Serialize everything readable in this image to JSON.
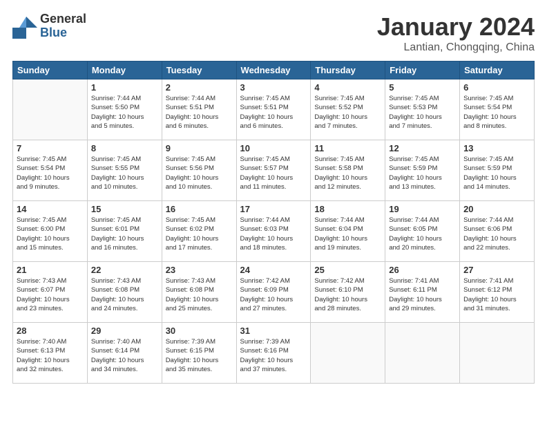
{
  "logo": {
    "general": "General",
    "blue": "Blue"
  },
  "title": {
    "month": "January 2024",
    "location": "Lantian, Chongqing, China"
  },
  "headers": [
    "Sunday",
    "Monday",
    "Tuesday",
    "Wednesday",
    "Thursday",
    "Friday",
    "Saturday"
  ],
  "weeks": [
    [
      {
        "day": "",
        "info": ""
      },
      {
        "day": "1",
        "info": "Sunrise: 7:44 AM\nSunset: 5:50 PM\nDaylight: 10 hours\nand 5 minutes."
      },
      {
        "day": "2",
        "info": "Sunrise: 7:44 AM\nSunset: 5:51 PM\nDaylight: 10 hours\nand 6 minutes."
      },
      {
        "day": "3",
        "info": "Sunrise: 7:45 AM\nSunset: 5:51 PM\nDaylight: 10 hours\nand 6 minutes."
      },
      {
        "day": "4",
        "info": "Sunrise: 7:45 AM\nSunset: 5:52 PM\nDaylight: 10 hours\nand 7 minutes."
      },
      {
        "day": "5",
        "info": "Sunrise: 7:45 AM\nSunset: 5:53 PM\nDaylight: 10 hours\nand 7 minutes."
      },
      {
        "day": "6",
        "info": "Sunrise: 7:45 AM\nSunset: 5:54 PM\nDaylight: 10 hours\nand 8 minutes."
      }
    ],
    [
      {
        "day": "7",
        "info": "Sunrise: 7:45 AM\nSunset: 5:54 PM\nDaylight: 10 hours\nand 9 minutes."
      },
      {
        "day": "8",
        "info": "Sunrise: 7:45 AM\nSunset: 5:55 PM\nDaylight: 10 hours\nand 10 minutes."
      },
      {
        "day": "9",
        "info": "Sunrise: 7:45 AM\nSunset: 5:56 PM\nDaylight: 10 hours\nand 10 minutes."
      },
      {
        "day": "10",
        "info": "Sunrise: 7:45 AM\nSunset: 5:57 PM\nDaylight: 10 hours\nand 11 minutes."
      },
      {
        "day": "11",
        "info": "Sunrise: 7:45 AM\nSunset: 5:58 PM\nDaylight: 10 hours\nand 12 minutes."
      },
      {
        "day": "12",
        "info": "Sunrise: 7:45 AM\nSunset: 5:59 PM\nDaylight: 10 hours\nand 13 minutes."
      },
      {
        "day": "13",
        "info": "Sunrise: 7:45 AM\nSunset: 5:59 PM\nDaylight: 10 hours\nand 14 minutes."
      }
    ],
    [
      {
        "day": "14",
        "info": "Sunrise: 7:45 AM\nSunset: 6:00 PM\nDaylight: 10 hours\nand 15 minutes."
      },
      {
        "day": "15",
        "info": "Sunrise: 7:45 AM\nSunset: 6:01 PM\nDaylight: 10 hours\nand 16 minutes."
      },
      {
        "day": "16",
        "info": "Sunrise: 7:45 AM\nSunset: 6:02 PM\nDaylight: 10 hours\nand 17 minutes."
      },
      {
        "day": "17",
        "info": "Sunrise: 7:44 AM\nSunset: 6:03 PM\nDaylight: 10 hours\nand 18 minutes."
      },
      {
        "day": "18",
        "info": "Sunrise: 7:44 AM\nSunset: 6:04 PM\nDaylight: 10 hours\nand 19 minutes."
      },
      {
        "day": "19",
        "info": "Sunrise: 7:44 AM\nSunset: 6:05 PM\nDaylight: 10 hours\nand 20 minutes."
      },
      {
        "day": "20",
        "info": "Sunrise: 7:44 AM\nSunset: 6:06 PM\nDaylight: 10 hours\nand 22 minutes."
      }
    ],
    [
      {
        "day": "21",
        "info": "Sunrise: 7:43 AM\nSunset: 6:07 PM\nDaylight: 10 hours\nand 23 minutes."
      },
      {
        "day": "22",
        "info": "Sunrise: 7:43 AM\nSunset: 6:08 PM\nDaylight: 10 hours\nand 24 minutes."
      },
      {
        "day": "23",
        "info": "Sunrise: 7:43 AM\nSunset: 6:08 PM\nDaylight: 10 hours\nand 25 minutes."
      },
      {
        "day": "24",
        "info": "Sunrise: 7:42 AM\nSunset: 6:09 PM\nDaylight: 10 hours\nand 27 minutes."
      },
      {
        "day": "25",
        "info": "Sunrise: 7:42 AM\nSunset: 6:10 PM\nDaylight: 10 hours\nand 28 minutes."
      },
      {
        "day": "26",
        "info": "Sunrise: 7:41 AM\nSunset: 6:11 PM\nDaylight: 10 hours\nand 29 minutes."
      },
      {
        "day": "27",
        "info": "Sunrise: 7:41 AM\nSunset: 6:12 PM\nDaylight: 10 hours\nand 31 minutes."
      }
    ],
    [
      {
        "day": "28",
        "info": "Sunrise: 7:40 AM\nSunset: 6:13 PM\nDaylight: 10 hours\nand 32 minutes."
      },
      {
        "day": "29",
        "info": "Sunrise: 7:40 AM\nSunset: 6:14 PM\nDaylight: 10 hours\nand 34 minutes."
      },
      {
        "day": "30",
        "info": "Sunrise: 7:39 AM\nSunset: 6:15 PM\nDaylight: 10 hours\nand 35 minutes."
      },
      {
        "day": "31",
        "info": "Sunrise: 7:39 AM\nSunset: 6:16 PM\nDaylight: 10 hours\nand 37 minutes."
      },
      {
        "day": "",
        "info": ""
      },
      {
        "day": "",
        "info": ""
      },
      {
        "day": "",
        "info": ""
      }
    ]
  ]
}
